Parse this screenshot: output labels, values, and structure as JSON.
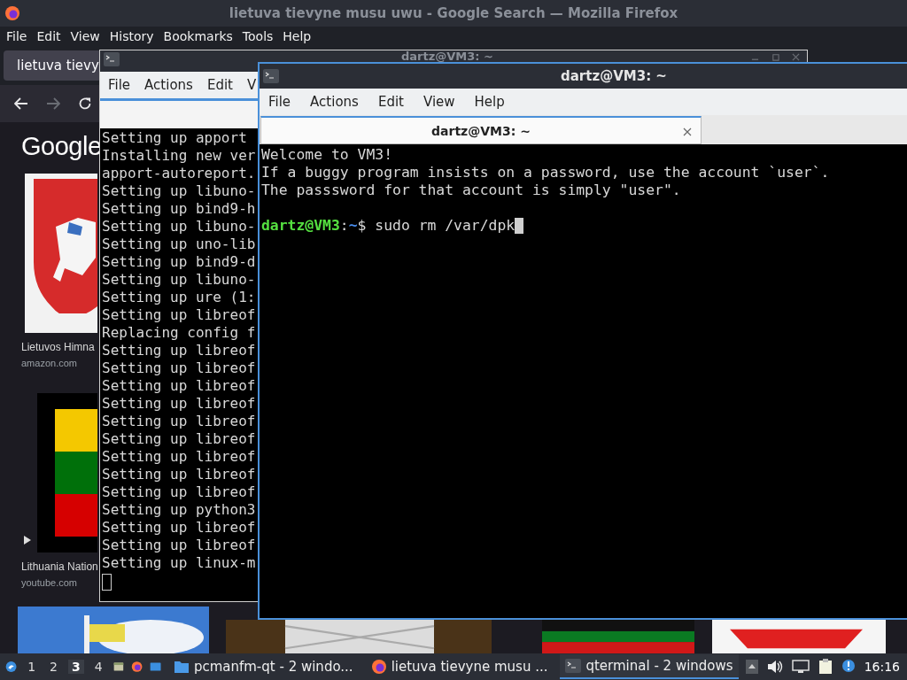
{
  "firefox": {
    "title": "lietuva tievyne musu uwu - Google Search — Mozilla Firefox",
    "menu": [
      "File",
      "Edit",
      "View",
      "History",
      "Bookmarks",
      "Tools",
      "Help"
    ],
    "tab": {
      "label": "lietuva tievy"
    },
    "logo": "Google",
    "results": [
      {
        "caption": "Lietuvos Himna",
        "source": "amazon.com"
      },
      {
        "kind": "video",
        "caption": "Lithuania Nation",
        "source": "youtube.com"
      }
    ]
  },
  "back_terminal": {
    "title": "dartz@VM3: ~",
    "menu": [
      "File",
      "Actions",
      "Edit",
      "V"
    ],
    "lines": [
      "Setting up apport",
      "Installing new ver",
      "apport-autoreport.",
      "Setting up libuno-",
      "Setting up bind9-h",
      "Setting up libuno-",
      "Setting up uno-lib",
      "Setting up bind9-d",
      "Setting up libuno-",
      "Setting up ure (1:",
      "Setting up libreof",
      "Replacing config f",
      "Setting up libreof",
      "Setting up libreof",
      "Setting up libreof",
      "Setting up libreof",
      "Setting up libreof",
      "Setting up libreof",
      "Setting up libreof",
      "Setting up libreof",
      "Setting up libreof",
      "Setting up python3",
      "Setting up libreof",
      "Setting up libreof",
      "Setting up linux-m"
    ]
  },
  "front_terminal": {
    "title": "dartz@VM3: ~",
    "menu": [
      "File",
      "Actions",
      "Edit",
      "View",
      "Help"
    ],
    "tabs": [
      {
        "label": "dartz@VM3: ~",
        "selected": true
      }
    ],
    "lines": [
      "Welcome to VM3!",
      "If a buggy program insists on a password, use the account `user`.",
      "The passsword for that account is simply \"user\"."
    ],
    "prompt": {
      "user_host": "dartz@VM3",
      "separator": ":",
      "path": "~",
      "command": "$ sudo rm /var/dpk"
    }
  },
  "taskbar": {
    "workspaces": [
      {
        "label": "1",
        "selected": false
      },
      {
        "label": "2",
        "selected": false
      },
      {
        "label": "3",
        "selected": true
      },
      {
        "label": "4",
        "selected": false
      }
    ],
    "tasks": [
      {
        "label": "pcmanfm-qt - 2 windo...",
        "kind": "folder",
        "selected": false
      },
      {
        "label": "lietuva tievyne musu ...",
        "kind": "firefox",
        "selected": false
      },
      {
        "label": "qterminal - 2 windows",
        "kind": "terminal",
        "selected": true
      }
    ],
    "clock": "16:16"
  }
}
